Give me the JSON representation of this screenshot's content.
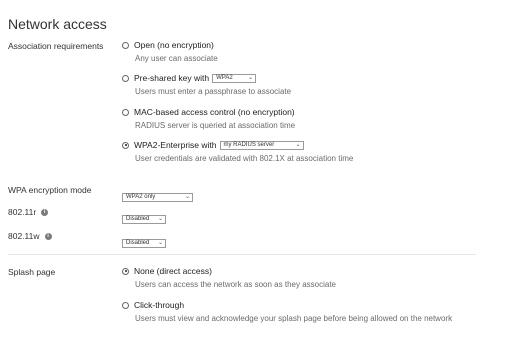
{
  "section": {
    "title": "Network access"
  },
  "association": {
    "label": "Association requirements",
    "options": [
      {
        "label": "Open (no encryption)",
        "desc": "Any user can associate",
        "checked": false
      },
      {
        "label": "Pre-shared key with",
        "select": "WPA2",
        "desc": "Users must enter a passphrase to associate",
        "checked": false
      },
      {
        "label": "MAC-based access control (no encryption)",
        "desc": "RADIUS server is queried at association time",
        "checked": false
      },
      {
        "label": "WPA2-Enterprise with",
        "select": "my RADIUS server",
        "desc": "User credentials are validated with 802.1X at association time",
        "checked": true
      }
    ]
  },
  "wpa_mode": {
    "label": "WPA encryption mode",
    "value": "WPA2 only"
  },
  "r80211r": {
    "label": "802.11r",
    "value": "Disabled"
  },
  "r80211w": {
    "label": "802.11w",
    "value": "Disabled"
  },
  "splash": {
    "label": "Splash page",
    "options": [
      {
        "label": "None (direct access)",
        "desc": "Users can access the network as soon as they associate",
        "checked": true
      },
      {
        "label": "Click-through",
        "desc": "Users must view and acknowledge your splash page before being allowed on the network",
        "checked": false
      }
    ]
  },
  "icons": {
    "info": "info-icon",
    "dropdown": "chevron-down-icon"
  }
}
